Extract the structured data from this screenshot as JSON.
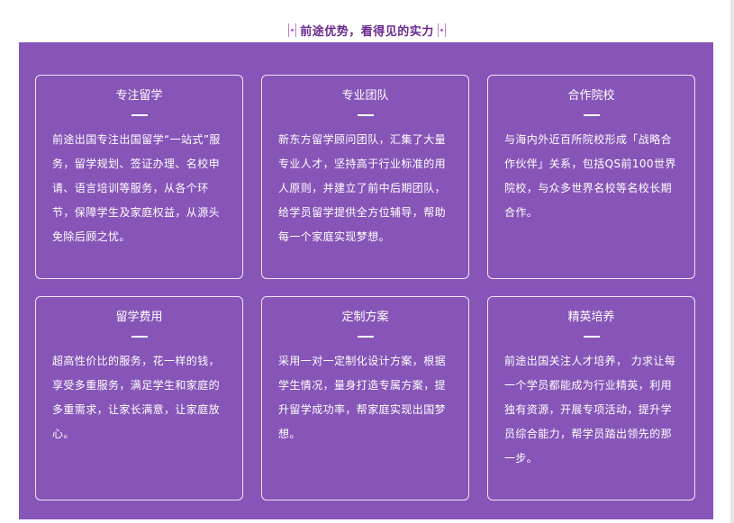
{
  "section": {
    "title": "前途优势，看得见的实力",
    "accent_color": "#8755b8",
    "title_color": "#6a2a8f"
  },
  "cards": [
    {
      "title": "专注留学",
      "text": "前途出国专注出国留学“一站式”服务，留学规划、签证办理、名校申请、语言培训等服务，从各个环节，保障学生及家庭权益，从源头免除后顾之忧。"
    },
    {
      "title": "专业团队",
      "text": "新东方留学顾问团队，汇集了大量专业人才，坚持高于行业标准的用人原则，并建立了前中后期团队，给学员留学提供全方位辅导，帮助每一个家庭实现梦想。"
    },
    {
      "title": "合作院校",
      "text": "与海内外近百所院校形成「战略合作伙伴」关系，包括QS前100世界院校，与众多世界名校等名校长期合作。"
    },
    {
      "title": "留学费用",
      "text": "超高性价比的服务，花一样的钱，享受多重服务，满足学生和家庭的多重需求，让家长满意，让家庭放心。"
    },
    {
      "title": "定制方案",
      "text": "采用一对一定制化设计方案，根据学生情况，量身打造专属方案，提升留学成功率，帮家庭实现出国梦想。"
    },
    {
      "title": "精英培养",
      "text": "前途出国关注人才培养， 力求让每一个学员都能成为行业精英，利用独有资源，开展专项活动，提升学员综合能力，帮学员踏出领先的那一步。"
    }
  ]
}
